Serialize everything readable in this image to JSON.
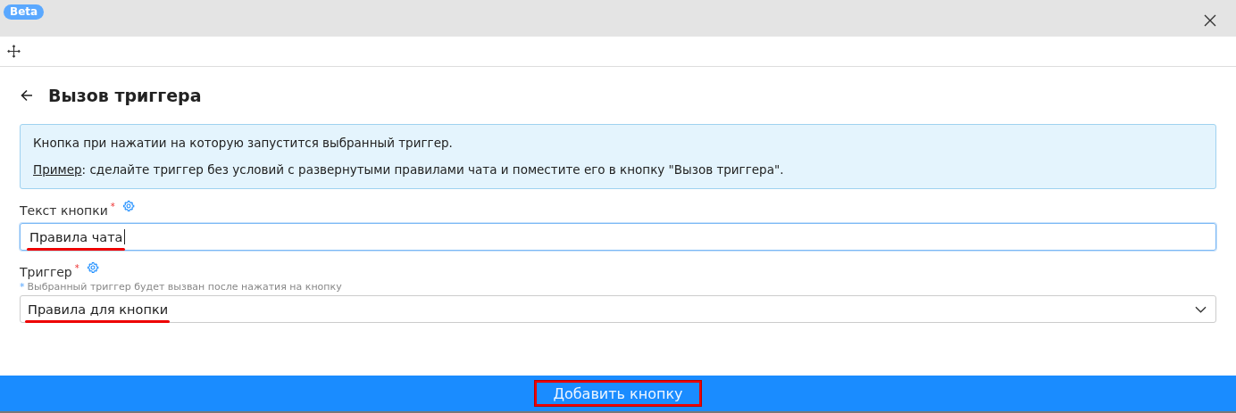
{
  "header": {
    "badge": "Beta"
  },
  "title": "Вызов триггера",
  "info": {
    "text": "Кнопка при нажатии на которую запустится выбранный триггер.",
    "example_link": "Пример",
    "example_text": ": сделайте триггер без условий с развернутыми правилами чата и поместите его в кнопку \"Вызов триггера\"."
  },
  "fields": [
    {
      "kind": "text",
      "label": "Текст кнопки",
      "required": "*",
      "value": "Правила чата",
      "focused": true,
      "marked": true
    },
    {
      "kind": "select",
      "label": "Триггер",
      "required": "*",
      "hint_mark": "*",
      "hint": "Выбранный триггер будет вызван после нажатия на кнопку",
      "value": "Правила для кнопки",
      "focused": false,
      "marked": true
    }
  ],
  "submit": {
    "label": "Добавить кнопку",
    "marked": true
  }
}
